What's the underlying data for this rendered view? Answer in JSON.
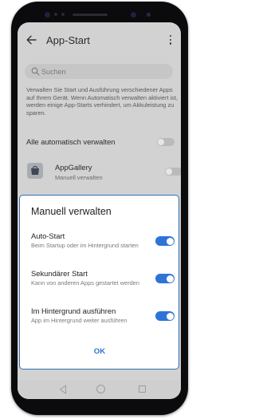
{
  "app_bar": {
    "title": "App-Start"
  },
  "search": {
    "placeholder": "Suchen"
  },
  "description": "Verwalten Sie Start und Ausführung verschiedener Apps auf Ihrem Gerät. Wenn Automatisch verwalten aktiviert ist, werden einige App-Starts verhindert, um Akkuleistung zu sparen.",
  "auto_manage": {
    "label": "Alle automatisch verwalten",
    "enabled": false
  },
  "apps": [
    {
      "name": "AppGallery",
      "status": "Manuell verwalten",
      "enabled": false,
      "icon": "appgallery-icon"
    }
  ],
  "dialog": {
    "title": "Manuell verwalten",
    "options": [
      {
        "name": "Auto-Start",
        "description": "Beim Startup oder im Hintergrund starten",
        "enabled": true
      },
      {
        "name": "Sekundärer Start",
        "description": "Kann von anderen Apps gestartet werden",
        "enabled": true
      },
      {
        "name": "Im Hintergrund ausführen",
        "description": "App im Hintergrund weiter ausführen",
        "enabled": true
      }
    ],
    "ok_label": "OK"
  },
  "colors": {
    "accent": "#2E74D8",
    "dialog_border": "#2A6FB3",
    "dim_background": "#D2D2D2"
  },
  "icons": {
    "back": "arrow-left-icon",
    "menu": "more-vertical-icon",
    "search": "search-icon",
    "nav_back": "triangle-back-icon",
    "nav_home": "circle-home-icon",
    "nav_recent": "square-recent-icon"
  }
}
